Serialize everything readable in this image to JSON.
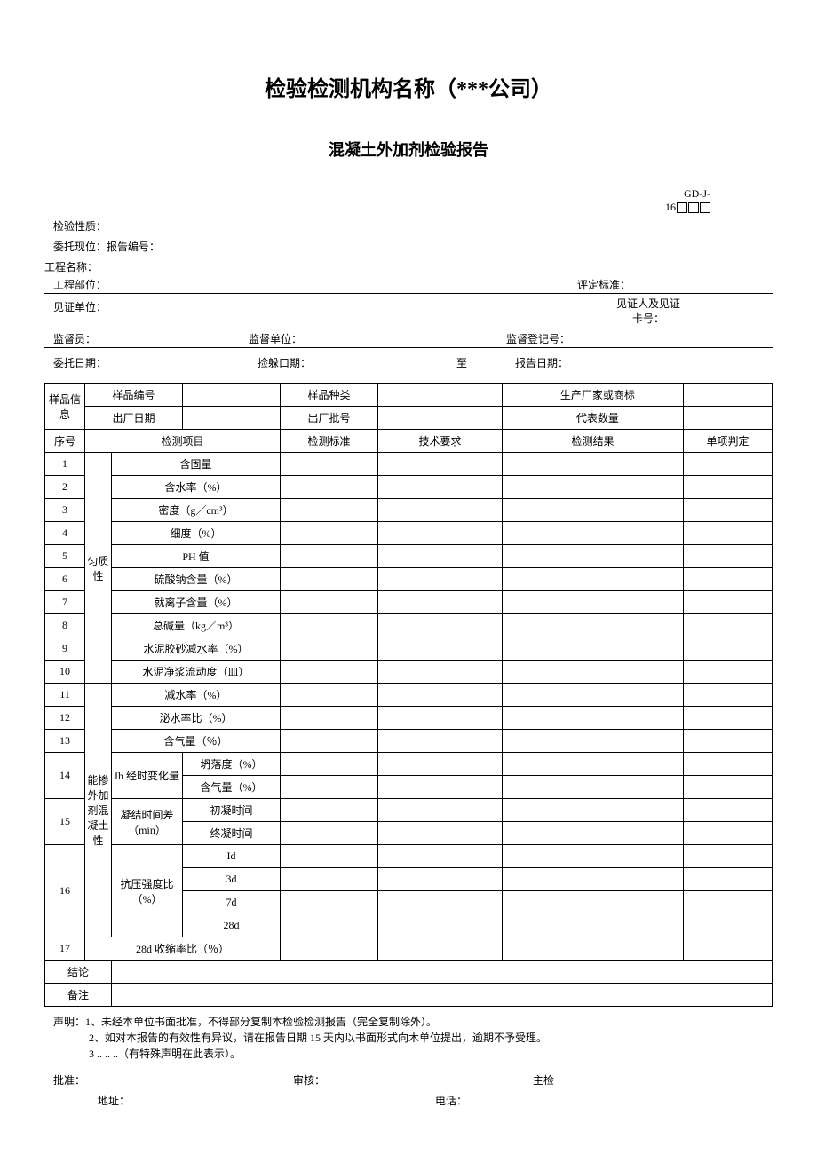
{
  "header": {
    "title": "检验检测机构名称（***公司）",
    "subtitle": "混凝土外加剂检验报告",
    "code_line1": "GD-J-",
    "code_line2_prefix": "16"
  },
  "meta": {
    "test_nature_label": "检验性质：",
    "entrust_unit_label": "委托现位：报告编号：",
    "project_name_label": "工程名称：",
    "project_part_label": "工程部位：",
    "standard_label": "评定标准：",
    "witness_unit_label": "见证单位：",
    "witness_person_label": "见证人及见证",
    "witness_card_label": "卡号：",
    "supervisor_label": "监督员：",
    "supervise_unit_label": "监督单位：",
    "supervise_reg_label": "监督登记号：",
    "entrust_date_label": "委托日期：",
    "test_date_label": "捡躲口期：",
    "to_label": "至",
    "report_date_label": "报告日期："
  },
  "table": {
    "sample_info": "样品信息",
    "sample_no": "样品编号",
    "sample_type": "样品种类",
    "manufacturer": "生产厂家或商标",
    "factory_date": "出厂日期",
    "batch_no": "出厂批号",
    "rep_qty": "代表数量",
    "seq": "序号",
    "test_item": "检测项目",
    "test_std": "检测标准",
    "tech_req": "技术要求",
    "test_result": "检测结果",
    "single_judge": "单项判定",
    "group1": "匀质性",
    "group2": "能掺外加剂混凝土性",
    "items": {
      "r1": "含固量",
      "r2": "含水率（%）",
      "r3": "密度（g／cm³）",
      "r4": "细度（%）",
      "r5": "PH 值",
      "r6": "硫酸钠含量（%）",
      "r7": "就离子含量（%）",
      "r8": "总碱量（kg／m³）",
      "r9": "水泥胶砂减水率（%）",
      "r10": "水泥净浆流动度（皿）",
      "r11": "减水率（%）",
      "r12": "泌水率比（%）",
      "r13": "含气量（％）",
      "r14a": "Ih 经时变化量",
      "r14b1": "坍落度（%）",
      "r14b2": "含气量（%）",
      "r15a": "凝结时间差（min）",
      "r15b1": "初凝时间",
      "r15b2": "终凝时间",
      "r16a": "抗压强度比（%）",
      "r16b1": "Id",
      "r16b2": "3d",
      "r16b3": "7d",
      "r16b4": "28d",
      "r17": "28d 收缩率比（％）"
    },
    "conclusion": "结论",
    "remark": "备注"
  },
  "footer": {
    "decl": "声明：1、未经本单位书面批准，不得部分复制本检验检测报告（完全复制除外）。",
    "decl2": "2、如对本报告的有效性有异议，请在报告日期 15 天内以书面形式向木单位提出，逾期不予受理。",
    "decl3": "3 .. .. ..（有特殊声明在此表示）。",
    "approve": "批准：",
    "review": "审核：",
    "inspector": "主检",
    "address": "地址：",
    "phone": "电话："
  }
}
